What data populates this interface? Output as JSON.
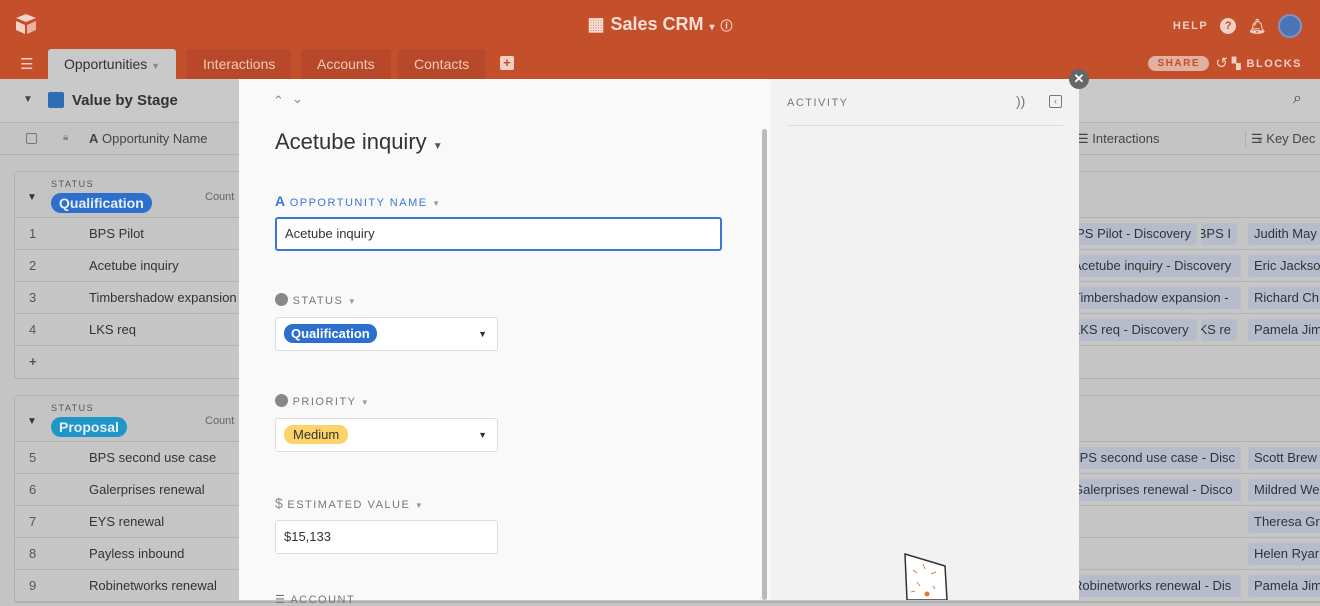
{
  "header": {
    "app_title": "Sales CRM",
    "help": "HELP",
    "share": "SHARE",
    "blocks": "BLOCKS"
  },
  "tabs": [
    "Opportunities",
    "Interactions",
    "Accounts",
    "Contacts"
  ],
  "toolbar": {
    "view_name": "Value by Stage"
  },
  "columns": {
    "name": "Opportunity Name",
    "interactions": "Interactions",
    "key": "Key Dec"
  },
  "groups": [
    {
      "label": "STATUS",
      "value": "Qualification",
      "color": "#2d6fcf",
      "count_label": "Count",
      "rows": [
        {
          "n": "1",
          "name": "BPS Pilot",
          "interactions": [
            "BPS Pilot - Discovery",
            "BPS I"
          ],
          "contact": "Judith May"
        },
        {
          "n": "2",
          "name": "Acetube inquiry",
          "interactions": [
            "Acetube inquiry - Discovery"
          ],
          "contact": "Eric Jackso"
        },
        {
          "n": "3",
          "name": "Timbershadow expansion",
          "interactions": [
            "Timbershadow expansion -"
          ],
          "contact": "Richard Ch"
        },
        {
          "n": "4",
          "name": "LKS req",
          "interactions": [
            "LKS req - Discovery",
            "LKS re"
          ],
          "contact": "Pamela Jim"
        }
      ]
    },
    {
      "label": "STATUS",
      "value": "Proposal",
      "color": "#1e96c8",
      "count_label": "Count",
      "rows": [
        {
          "n": "5",
          "name": "BPS second use case",
          "interactions": [
            "BPS second use case - Disc"
          ],
          "contact": "Scott Brew"
        },
        {
          "n": "6",
          "name": "Galerprises renewal",
          "interactions": [
            "Galerprises renewal - Disco"
          ],
          "contact": "Mildred We"
        },
        {
          "n": "7",
          "name": "EYS renewal",
          "interactions": [],
          "contact": "Theresa Gr"
        },
        {
          "n": "8",
          "name": "Payless inbound",
          "interactions": [],
          "contact": "Helen Ryar"
        },
        {
          "n": "9",
          "name": "Robinetworks renewal",
          "interactions": [
            "Robinetworks renewal - Dis"
          ],
          "contact": "Pamela Jim"
        }
      ]
    }
  ],
  "add_row": "+",
  "record": {
    "title": "Acetube inquiry",
    "fields": {
      "name_label": "OPPORTUNITY NAME",
      "name_value": "Acetube inquiry",
      "status_label": "STATUS",
      "status_value": "Qualification",
      "priority_label": "PRIORITY",
      "priority_value": "Medium",
      "value_label": "ESTIMATED VALUE",
      "value_value": "$15,133",
      "account_label": "ACCOUNT"
    }
  },
  "activity": {
    "title": "ACTIVITY"
  },
  "colors": {
    "brand": "#c44f2b",
    "qualification": "#2d6fcf",
    "medium": "#fcd36b"
  }
}
